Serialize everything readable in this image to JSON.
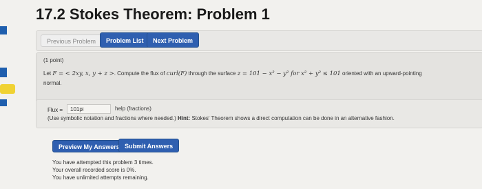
{
  "page": {
    "title": "17.2 Stokes Theorem: Problem 1"
  },
  "toolbar": {
    "previous_label": "Previous Problem",
    "list_label": "Problem List",
    "next_label": "Next Problem"
  },
  "problem": {
    "points": "(1 point)",
    "statement_prefix": "Let ",
    "statement_math": "F = < 2xy, x, y + z >",
    "statement_mid": ". Compute the flux of ",
    "curl_math": "curl(F)",
    "statement_mid2": " through the surface ",
    "surface_math": "z = 101 − x² − y² for x² + y² ≤ 101",
    "statement_suffix": " oriented with an upward-pointing",
    "statement_line2": "normal."
  },
  "answer": {
    "flux_label": "Flux =",
    "flux_value": "101pi",
    "help_label": "help (fractions)",
    "note_prefix": "(Use symbolic notation and fractions where needed.) ",
    "hint_label": "Hint:",
    "hint_text": " Stokes' Theorem shows a direct computation can be done in an alternative fashion."
  },
  "actions": {
    "preview_label": "Preview My Answers",
    "submit_label": "Submit Answers"
  },
  "status": {
    "attempts": "You have attempted this problem 3 times.",
    "score": "Your overall recorded score is 0%.",
    "remaining": "You have unlimited attempts remaining."
  },
  "colors": {
    "primary_button": "#2f5fb0",
    "left_tab_blue": "#1f5fae",
    "left_tab_yellow": "#f0d233"
  }
}
